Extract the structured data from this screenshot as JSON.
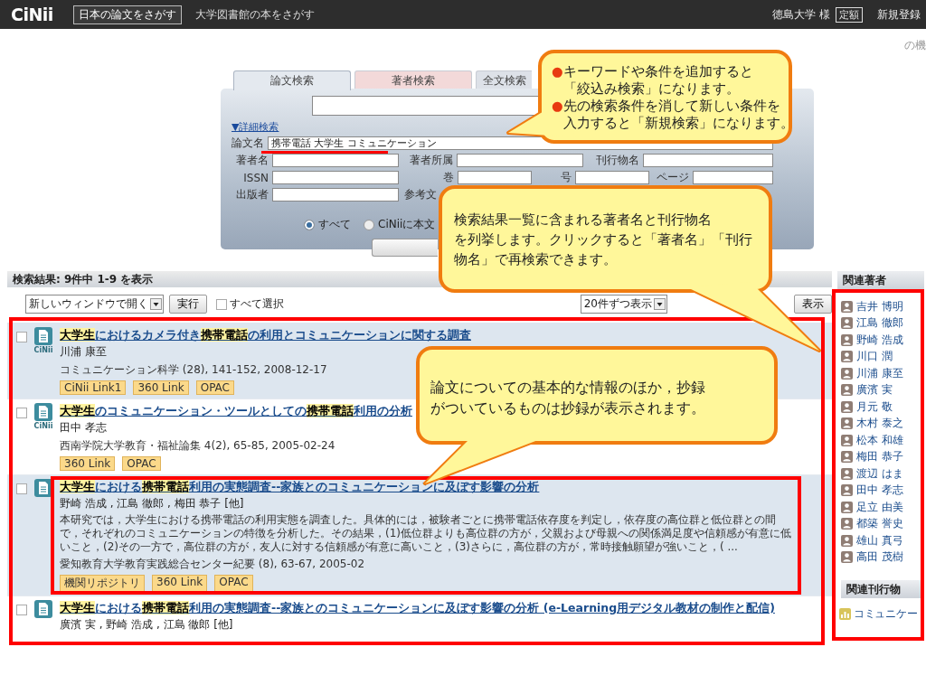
{
  "top_bar": {
    "logo": "CiNii",
    "nav": [
      {
        "label": "日本の論文をさがす",
        "selected": true
      },
      {
        "label": "大学図書館の本をさがす",
        "selected": false
      }
    ],
    "user": "徳島大学 様",
    "plan_badge": "定額",
    "register_link": "新規登録"
  },
  "corner_text": "の機",
  "search": {
    "tabs": [
      {
        "label": "論文検索",
        "selected": true,
        "color": "#e4e9ef"
      },
      {
        "label": "著者検索",
        "selected": false,
        "color": "#f3d9d9"
      },
      {
        "label": "全文検索",
        "selected": false,
        "color": "#dde1e8"
      }
    ],
    "advanced_link": "▼詳細検索",
    "form_rows": [
      {
        "fields": [
          {
            "label": "論文名",
            "kind": "input",
            "value": "携帯電話 大学生 コミュニケーション"
          }
        ]
      },
      {
        "fields": [
          {
            "label": "著者名",
            "kind": "input"
          },
          {
            "label": "著者所属",
            "kind": "input"
          },
          {
            "label": "刊行物名",
            "kind": "input"
          }
        ]
      },
      {
        "fields": [
          {
            "label": "ISSN",
            "kind": "input"
          },
          {
            "label": "巻",
            "kind": "input"
          },
          {
            "label": "号",
            "kind": "input"
          },
          {
            "label": "ページ",
            "kind": "input"
          }
        ]
      },
      {
        "fields": [
          {
            "label": "出版者",
            "kind": "input"
          },
          {
            "label": "参考文",
            "kind": "label"
          }
        ]
      }
    ],
    "radios": [
      {
        "label": "すべて",
        "selected": true
      },
      {
        "label": "CiNiiに本文",
        "selected": false
      }
    ]
  },
  "results_header": "検索結果:  9件中 1-9 を表示",
  "toolbar": {
    "open_select": "新しいウィンドウで開く",
    "run_button": "実行",
    "select_all": {
      "label": "すべて選択",
      "checked": false
    },
    "per_page_select": "20件ずつ表示",
    "show_button": "表示"
  },
  "results": [
    {
      "highlighted": true,
      "framed": false,
      "checked": false,
      "source_label": "CiNii",
      "title": "**大学生**におけるカメラ付き**携帯電話**の利用とコミュニケーションに関する調査",
      "authors": "川浦 康至",
      "journal": "コミュニケーション科学 (28), 141-152, 2008-12-17",
      "links": [
        "CiNii Link1",
        "360 Link",
        "OPAC"
      ]
    },
    {
      "highlighted": false,
      "framed": false,
      "checked": false,
      "source_label": "CiNii",
      "title": "**大学生**のコミュニケーション・ツールとしての**携帯電話**利用の分析",
      "authors": "田中 孝志",
      "journal": "西南学院大学教育・福祉論集 4(2), 65-85, 2005-02-24",
      "links": [
        "360 Link",
        "OPAC"
      ]
    },
    {
      "highlighted": true,
      "framed": true,
      "checked": false,
      "title": "**大学生**における**携帯電話**利用の実態調査--家族とのコミュニケーションに及ぼす影響の分析",
      "authors": "野崎 浩成 , 江島 徹郎 , 梅田 恭子 [他]",
      "abstract": "本研究では，大学生における携帯電話の利用実態を調査した。具体的には，被験者ごとに携帯電話依存度を判定し，依存度の高位群と低位群との間で，それぞれのコミュニケーションの特徴を分析した。その結果，(1)低位群よりも高位群の方が，父親および母親への関係満足度や信頼感が有意に低いこと，(2)その一方で，高位群の方が，友人に対する信頼感が有意に高いこと，(3)さらに，高位群の方が，常時接触願望が強いこと，( ...",
      "journal": "愛知教育大学教育実践総合センター紀要 (8), 63-67, 2005-02",
      "links": [
        "機関リポジトリ",
        "360 Link",
        "OPAC"
      ]
    },
    {
      "highlighted": false,
      "framed": false,
      "checked": false,
      "title": "**大学生**における**携帯電話**利用の実態調査--家族とのコミュニケーションに及ぼす影響の分析 (e-Learning用デジタル教材の制作と配信)",
      "authors": "廣濱 実 , 野崎 浩成 , 江島 徹郎 [他]"
    }
  ],
  "sidebar": {
    "authors_heading": "関連著者",
    "authors": [
      "吉井 博明",
      "江島 徹郎",
      "野崎 浩成",
      "川口 潤",
      "川浦 康至",
      "廣濱 実",
      "月元 敬",
      "木村 泰之",
      "松本 和雄",
      "梅田 恭子",
      "渡辺 はま",
      "田中 孝志",
      "足立 由美",
      "都築 誉史",
      "雄山 真弓",
      "高田 茂樹"
    ],
    "journals_heading": "関連刊行物",
    "journals": [
      "コミュニケー"
    ]
  },
  "callouts": [
    {
      "kind": "bulleted",
      "items": [
        {
          "marker": "●",
          "lines": [
            "キーワードや条件を追加すると",
            "「絞込み検索」になります。"
          ]
        },
        {
          "marker": "●",
          "lines": [
            "先の検索条件を消して新しい条件を",
            "入力すると「新規検索」になります。"
          ]
        }
      ]
    },
    {
      "kind": "plain",
      "lines": [
        "検索結果一覧に含まれる著者名と刊行物名",
        "を列挙します。クリックすると「著者名」「刊行",
        "物名」で再検索できます。"
      ]
    },
    {
      "kind": "plain",
      "lines": [
        "論文についての基本的な情報のほか，抄録",
        "がついているものは抄録が表示されます。"
      ]
    }
  ]
}
